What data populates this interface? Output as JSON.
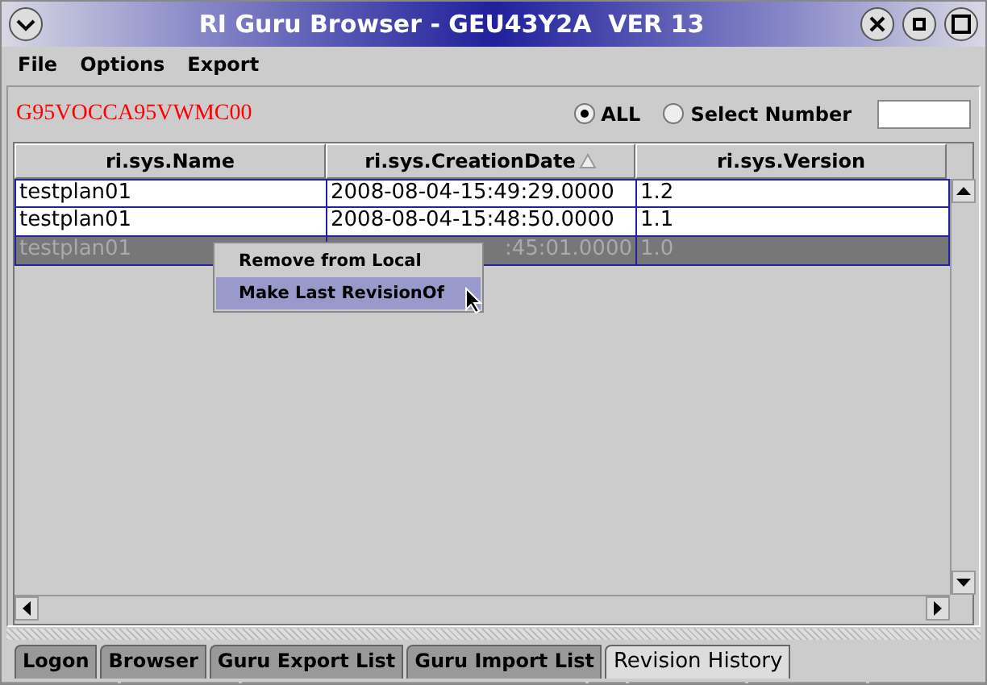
{
  "window": {
    "title": "RI Guru Browser - GEU43Y2A  VER 13"
  },
  "menu": [
    "File",
    "Options",
    "Export"
  ],
  "record_id": "G95VOCCA95VWMC00",
  "filter": {
    "options": [
      {
        "label": "ALL",
        "selected": true
      },
      {
        "label": "Select Number",
        "selected": false
      }
    ]
  },
  "table": {
    "columns": [
      {
        "label": "ri.sys.Name",
        "sorted": false
      },
      {
        "label": "ri.sys.CreationDate",
        "sorted": true
      },
      {
        "label": "ri.sys.Version",
        "sorted": false
      }
    ],
    "rows": [
      {
        "selected": false,
        "cells": [
          {
            "text": "testplan01"
          },
          {
            "text": "2008-08-04-15:49:29.0000"
          },
          {
            "text": "1.2"
          }
        ]
      },
      {
        "selected": false,
        "cells": [
          {
            "text": "testplan01"
          },
          {
            "text": "2008-08-04-15:48:50.0000"
          },
          {
            "text": "1.1"
          }
        ]
      },
      {
        "selected": true,
        "cells": [
          {
            "text": "testplan01"
          },
          {
            "text": ":45:01.0000",
            "covered": true
          },
          {
            "text": "1.0"
          }
        ]
      }
    ]
  },
  "context_menu": {
    "items": [
      {
        "label": "Remove from Local",
        "selected": false
      },
      {
        "label": "Make Last RevisionOf",
        "selected": true
      }
    ]
  },
  "tabs": [
    {
      "label": "Logon",
      "selected": false
    },
    {
      "label": "Browser",
      "selected": false
    },
    {
      "label": "Guru Export List",
      "selected": false
    },
    {
      "label": "Guru Import List",
      "selected": false
    },
    {
      "label": "Revision History",
      "selected": true
    }
  ]
}
